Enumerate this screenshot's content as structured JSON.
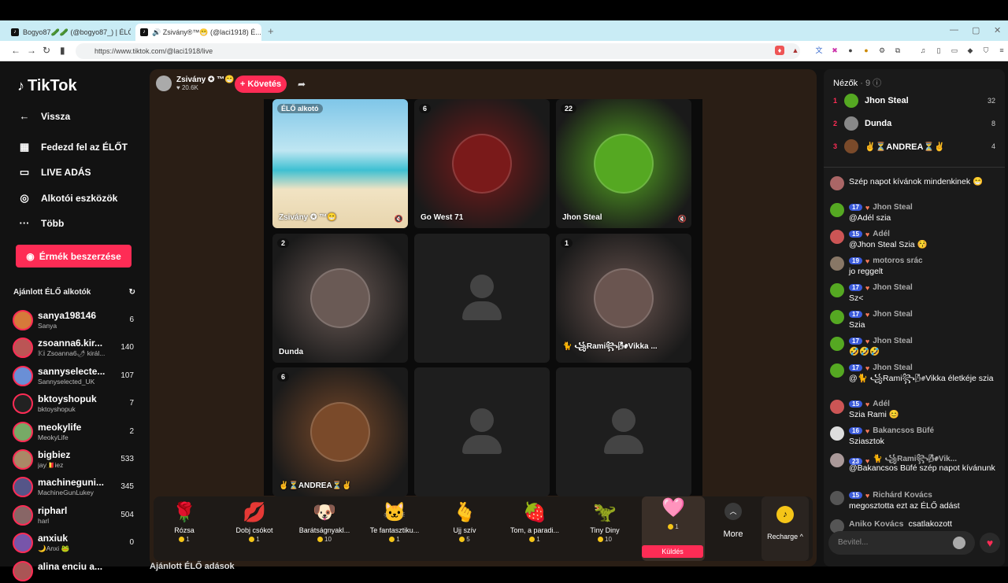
{
  "browser": {
    "tabs": [
      {
        "label": "Bogyo87🥒🥒 (@bogyo87_) | ÉLŐ a..."
      },
      {
        "label": "🔊 Zsivány®™😁 (@laci1918) É..."
      }
    ],
    "new_tab": "+",
    "url": "https://www.tiktok.com/@laci1918/live"
  },
  "sidebar": {
    "logo": "TikTok",
    "back": "Vissza",
    "nav": [
      {
        "label": "Fedezd fel az ÉLŐT",
        "icon": "calendar-icon"
      },
      {
        "label": "LIVE ADÁS",
        "icon": "camera-icon"
      },
      {
        "label": "Alkotói eszközök",
        "icon": "lightbulb-icon"
      },
      {
        "label": "Több",
        "icon": "dots-icon"
      }
    ],
    "coins_button": "Érmék beszerzése",
    "recommended_title": "Ajánlott ÉLŐ alkotók",
    "creators": [
      {
        "name": "sanya198146",
        "sub": "Sanya",
        "count": "6",
        "color": "#d67a3a"
      },
      {
        "name": "zsoanna6.kir...",
        "sub": "𝕂𝕚 Zsoanna6🌶 királ...",
        "count": "140",
        "color": "#b55"
      },
      {
        "name": "sannyselecte...",
        "sub": "Sannyselected_UK",
        "count": "107",
        "color": "#6a8fd6"
      },
      {
        "name": "bktoyshopuk",
        "sub": "bktoyshopuk",
        "count": "7",
        "color": "#222"
      },
      {
        "name": "meokylife",
        "sub": "MeokyLife",
        "count": "2",
        "color": "#7a6"
      },
      {
        "name": "bigbiez",
        "sub": "jay🇧🇪iez",
        "count": "533",
        "color": "#a86"
      },
      {
        "name": "machineguni...",
        "sub": "MachineGunLukey",
        "count": "345",
        "color": "#558"
      },
      {
        "name": "ripharl",
        "sub": "harl",
        "count": "504",
        "color": "#866"
      },
      {
        "name": "anxiuk",
        "sub": "🌙Anxi 🐸",
        "count": "0",
        "color": "#75a"
      },
      {
        "name": "alina enciu a...",
        "sub": "",
        "count": "",
        "color": "#a55"
      }
    ]
  },
  "stage": {
    "host_name": "Zsivány ✪ ™😁",
    "host_likes": "♥ 20.6K",
    "follow": "+ Követés",
    "cells": [
      {
        "badge": "ÉLŐ alkotó",
        "label": "Zsivány ✪ ™😁",
        "kind": "beach",
        "muted": true
      },
      {
        "badge": "6",
        "label": "Go West 71",
        "kind": "face",
        "color": "#7a1a1a",
        "muted": false
      },
      {
        "badge": "22",
        "label": "Jhon Steal",
        "kind": "face",
        "color": "#55a822",
        "muted": true
      },
      {
        "badge": "2",
        "label": "Dunda",
        "kind": "face",
        "color": "#6a5a55",
        "muted": false
      },
      {
        "badge": "",
        "label": "",
        "kind": "empty",
        "muted": false
      },
      {
        "badge": "1",
        "label": "🐈 ꧁Rami꧂🌬Vikka ...",
        "kind": "face",
        "color": "#6a5550",
        "muted": false
      },
      {
        "badge": "6",
        "label": "✌⏳ANDREA⏳✌",
        "kind": "face",
        "color": "#7a4a2a",
        "muted": false
      },
      {
        "badge": "",
        "label": "",
        "kind": "empty",
        "muted": false
      },
      {
        "badge": "",
        "label": "",
        "kind": "empty",
        "muted": false
      }
    ],
    "below_title": "Ajánlott ÉLŐ adások"
  },
  "gifts": {
    "items": [
      {
        "emoji": "🌹",
        "name": "Rózsa",
        "price": "1"
      },
      {
        "emoji": "💋",
        "name": "Dobj csókot",
        "price": "1"
      },
      {
        "emoji": "🐶",
        "name": "Barátságnyakl...",
        "price": "10"
      },
      {
        "emoji": "🐱",
        "name": "Te fantasztiku...",
        "price": "1"
      },
      {
        "emoji": "🫰",
        "name": "Ujj szív",
        "price": "5"
      },
      {
        "emoji": "🍓",
        "name": "Tom, a paradi...",
        "price": "1"
      },
      {
        "emoji": "🦖",
        "name": "Tiny Diny",
        "price": "10"
      }
    ],
    "selected": {
      "emoji": "🩷",
      "price": "1",
      "send": "Küldés"
    },
    "more": "More",
    "recharge": "Recharge ^"
  },
  "right": {
    "viewers_title": "Nézők",
    "viewers_count": "· 9",
    "viewers": [
      {
        "rank": "1",
        "name": "Jhon Steal",
        "score": "32",
        "color": "#55a822"
      },
      {
        "rank": "2",
        "name": "Dunda",
        "score": "8",
        "color": "#888"
      },
      {
        "rank": "3",
        "name": "✌⏳ANDREA⏳✌",
        "score": "4",
        "color": "#7a4a2a"
      }
    ],
    "messages": [
      {
        "type": "chat",
        "name": "",
        "level": "",
        "text": "Szép napot kívánok mindenkinek 😁",
        "color": "#a66"
      },
      {
        "type": "chat",
        "name": "Jhon Steal",
        "level": "17",
        "text": "@Adél szia",
        "color": "#55a822"
      },
      {
        "type": "chat",
        "name": "Adél",
        "level": "15",
        "text": "@Jhon Steal Szia 😚",
        "color": "#c55"
      },
      {
        "type": "chat",
        "name": "motoros srác",
        "level": "19",
        "text": "jo reggelt",
        "color": "#876"
      },
      {
        "type": "chat",
        "name": "Jhon Steal",
        "level": "17",
        "text": "Sz<",
        "color": "#55a822"
      },
      {
        "type": "chat",
        "name": "Jhon Steal",
        "level": "17",
        "text": "Szia",
        "color": "#55a822"
      },
      {
        "type": "chat",
        "name": "Jhon Steal",
        "level": "17",
        "text": "🤣🤣🤣",
        "color": "#55a822"
      },
      {
        "type": "chat",
        "name": "Jhon Steal",
        "level": "17",
        "text": "@🐈 ꧁Rami꧂🌬Vikka életkéje szia",
        "color": "#55a822"
      },
      {
        "type": "chat",
        "name": "Adél",
        "level": "15",
        "text": "Szia Rami 😊",
        "color": "#c55"
      },
      {
        "type": "chat",
        "name": "Bakancsos Büfé",
        "level": "16",
        "text": "Sziasztok",
        "color": "#ddd"
      },
      {
        "type": "chat",
        "name": "🐈 ꧁Rami꧂🌬Vik...",
        "level": "23",
        "text": "@Bakancsos Büfé szép napot kívánunk",
        "color": "#a99"
      },
      {
        "type": "chat",
        "name": "Richárd Kovács",
        "level": "15",
        "text": "megosztotta ezt az ÉLŐ adást",
        "color": "#555"
      },
      {
        "type": "sys",
        "name": "Aniko Kovács",
        "level": "",
        "text": "csatlakozott",
        "color": "#555"
      }
    ],
    "input_placeholder": "Bevitel..."
  }
}
